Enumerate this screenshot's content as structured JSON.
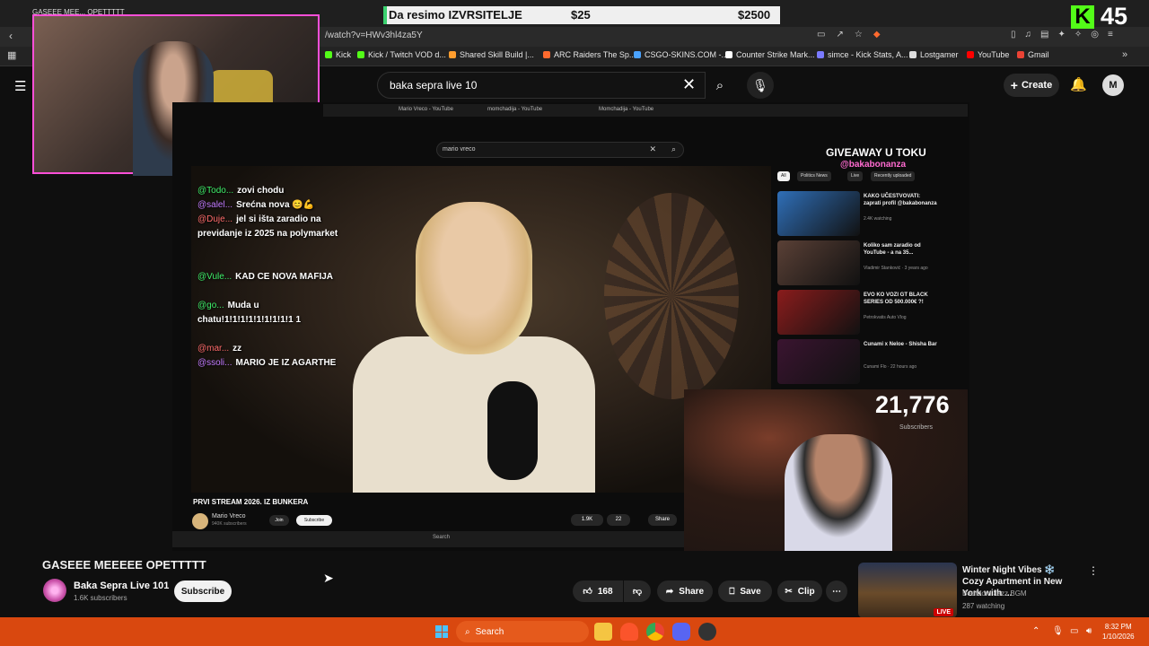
{
  "browser": {
    "tab_title": "GASEEE MEE... OPETTTTT",
    "url": "/watch?v=HWv3hl4za5Y",
    "bookmarks": [
      {
        "label": "Kick",
        "color": "#53fc18"
      },
      {
        "label": "Kick / Twitch VOD d...",
        "color": "#53fc18"
      },
      {
        "label": "Shared Skill Build |...",
        "color": "#ff9d2e"
      },
      {
        "label": "ARC Raiders The Sp...",
        "color": "#ff6a2e"
      },
      {
        "label": "CSGO-SKINS.COM -...",
        "color": "#4aa3ff"
      },
      {
        "label": "Counter Strike Mark...",
        "color": "#ffffff"
      },
      {
        "label": "simce - Kick Stats, A...",
        "color": "#7a7aff"
      },
      {
        "label": "Lostgamer",
        "color": "#dddddd"
      },
      {
        "label": "YouTube",
        "color": "#ff0000"
      },
      {
        "label": "Gmail",
        "color": "#ea4335"
      }
    ]
  },
  "overlay": {
    "banner_title": "Da resimo IZVRSITELJE",
    "banner_current": "$25",
    "banner_goal": "$2500",
    "kick_letter": "K",
    "viewer_count": "45"
  },
  "youtube": {
    "search_value": "baka sepra live 10",
    "create_label": "Create",
    "avatar_letter": "M"
  },
  "inner_screen": {
    "search_value": "mario vreco",
    "tabs": [
      "Mario Vreco - YouTube",
      "momchadija - YouTube",
      "Momchadija - YouTube"
    ],
    "chat": [
      {
        "user": "@Todo...",
        "msg": "zovi chodu",
        "ucolor": "#3ef06a"
      },
      {
        "user": "@salel...",
        "msg": "Srećna nova 😊💪",
        "ucolor": "#c27bff"
      },
      {
        "user": "@Duje...",
        "msg": "jel si išta zaradio na previdanje iz 2025 na polymarket",
        "ucolor": "#ff6b6b"
      },
      {
        "user": "@Vule...",
        "msg": "KAD CE NOVA MAFIJA",
        "ucolor": "#3ef06a"
      },
      {
        "user": "@go...",
        "msg": "Muda u chatu!1!1!1!1!1!1!1!1!1 1",
        "ucolor": "#3ef06a"
      },
      {
        "user": "@mar...",
        "msg": "zz",
        "ucolor": "#ff6b6b"
      },
      {
        "user": "@ssoli...",
        "msg": "MARIO JE IZ AGARTHE",
        "ucolor": "#c27bff"
      }
    ],
    "video_title": "PRVI STREAM 2026. IZ BUNKERA",
    "video_channel": "Mario Vreco",
    "video_channel_subs": "940K subscribers",
    "join_label": "Join",
    "subscribe_label": "Subscribe",
    "likes": "1.9K",
    "dislikes": "22",
    "share_label": "Share",
    "taskbar_search": "Search",
    "giveaway_title": "GIVEAWAY U TOKU",
    "giveaway_handle": "@bakabonanza",
    "chips": [
      "All",
      "Politics News",
      "Live",
      "Recently uploaded"
    ],
    "recs": [
      {
        "title": "KAKO UČESTVOVATI: zaprati profil @bakabonanza",
        "meta": "2.4K watching",
        "color": "#2f6fb8"
      },
      {
        "title": "Koliko sam zaradio od YouTube - a na 35...",
        "meta": "Vladimir Stanković · 3 years ago",
        "color": "#5a4036"
      },
      {
        "title": "EVO KO VOZI GT BLACK SERIES OD 500.000€ ?!",
        "meta": "Petrokvatis Auto Vlog",
        "color": "#8a1c1c"
      },
      {
        "title": "Cunami x Neloe - Shisha Bar",
        "meta": "Cunami Flo · 22 hours ago",
        "color": "#3a1430"
      }
    ],
    "subscriber_count": "21,776",
    "subscriber_label": "Subscribers"
  },
  "video": {
    "title": "GASEEE MEEEEE OPETTTTT",
    "channel": "Baka Sepra Live 101",
    "subscribers": "1.6K subscribers",
    "subscribe_label": "Subscribe",
    "likes": "168",
    "share_label": "Share",
    "save_label": "Save",
    "clip_label": "Clip"
  },
  "up_next": {
    "title": "Winter Night Vibes ❄️ Cozy Apartment in New York with ...",
    "channel": "Bedroom Jazz BGM",
    "watching": "287 watching",
    "badge": "LIVE"
  },
  "taskbar": {
    "search_label": "Search",
    "time": "8:32 PM",
    "date": "1/10/2026"
  }
}
